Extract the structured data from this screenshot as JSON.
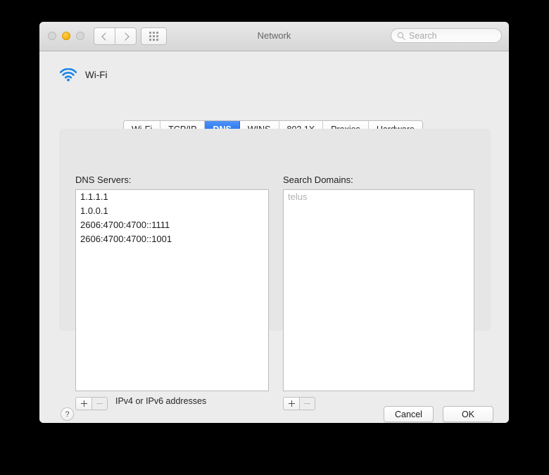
{
  "window": {
    "title": "Network",
    "traffic_lights": [
      {
        "name": "close",
        "state": "disabled"
      },
      {
        "name": "minimize",
        "state": "enabled",
        "color": "#f8b200"
      },
      {
        "name": "zoom",
        "state": "disabled"
      }
    ],
    "nav": {
      "back_icon": "chevron-left-icon",
      "forward_icon": "chevron-right-icon",
      "showall_icon": "grid-icon"
    },
    "search": {
      "placeholder": "Search",
      "value": "",
      "icon": "search-icon"
    }
  },
  "interface": {
    "icon": "wifi-icon",
    "label": "Wi-Fi",
    "accent": "#1a84e8"
  },
  "tabs": [
    {
      "label": "Wi-Fi",
      "active": false
    },
    {
      "label": "TCP/IP",
      "active": false
    },
    {
      "label": "DNS",
      "active": true
    },
    {
      "label": "WINS",
      "active": false
    },
    {
      "label": "802.1X",
      "active": false
    },
    {
      "label": "Proxies",
      "active": false
    },
    {
      "label": "Hardware",
      "active": false
    }
  ],
  "tab_accent": "#1667ef",
  "dns_servers": {
    "label": "DNS Servers:",
    "items": [
      "1.1.1.1",
      "1.0.0.1",
      "2606:4700:4700::1111",
      "2606:4700:4700::1001"
    ],
    "add_label": "+",
    "remove_label": "–",
    "remove_enabled": false,
    "hint": "IPv4 or IPv6 addresses"
  },
  "search_domains": {
    "label": "Search Domains:",
    "items": [],
    "placeholder_item": "telus",
    "add_label": "+",
    "remove_label": "–",
    "remove_enabled": false
  },
  "footer": {
    "help_label": "?",
    "cancel_label": "Cancel",
    "ok_label": "OK"
  }
}
